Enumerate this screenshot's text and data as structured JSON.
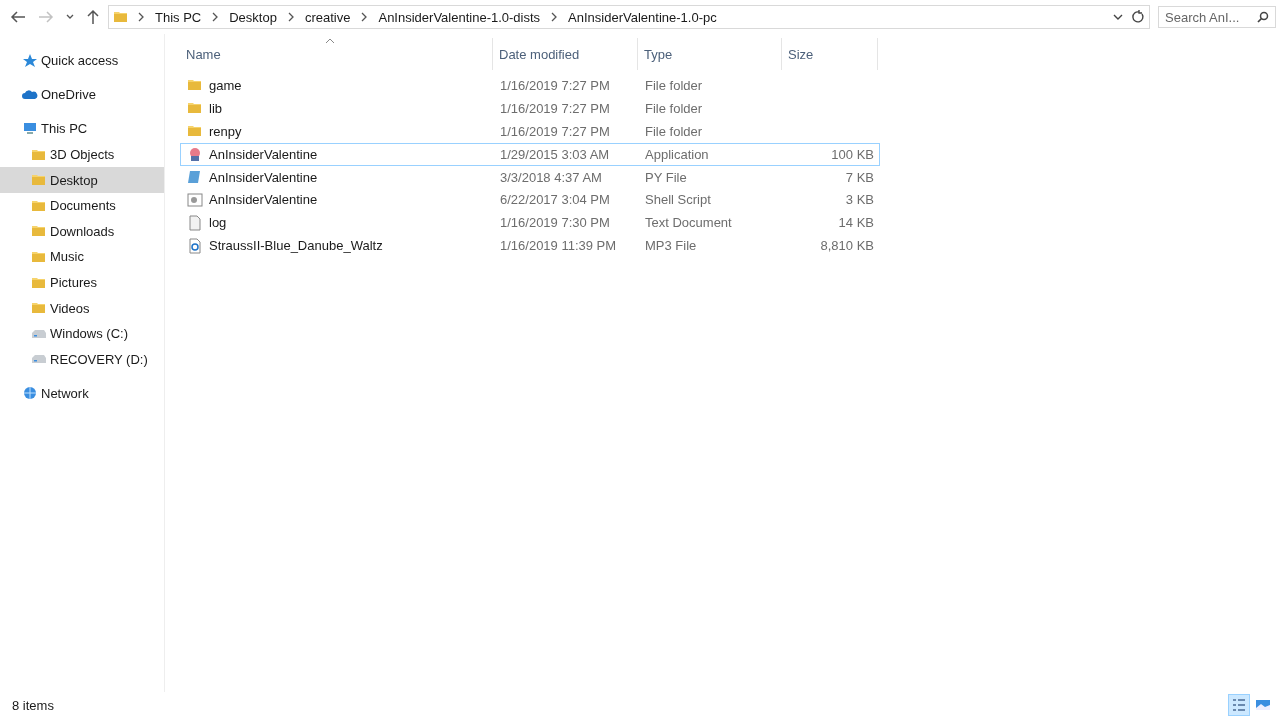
{
  "nav": {
    "back": {
      "disabled": false
    },
    "forward": {
      "disabled": true
    }
  },
  "address": {
    "segments": [
      "This PC",
      "Desktop",
      "creative",
      "AnInsiderValentine-1.0-dists",
      "AnInsiderValentine-1.0-pc"
    ]
  },
  "search": {
    "placeholder": "Search AnI..."
  },
  "sidebar": {
    "items": [
      {
        "label": "Quick access",
        "kind": "star",
        "selected": false
      },
      {
        "label": "OneDrive",
        "kind": "cloud",
        "selected": false
      },
      {
        "label": "This PC",
        "kind": "pc",
        "selected": false,
        "children": [
          {
            "label": "3D Objects",
            "kind": "folder",
            "selected": false
          },
          {
            "label": "Desktop",
            "kind": "folder",
            "selected": true
          },
          {
            "label": "Documents",
            "kind": "folder",
            "selected": false
          },
          {
            "label": "Downloads",
            "kind": "folder",
            "selected": false
          },
          {
            "label": "Music",
            "kind": "folder",
            "selected": false
          },
          {
            "label": "Pictures",
            "kind": "folder",
            "selected": false
          },
          {
            "label": "Videos",
            "kind": "folder",
            "selected": false
          },
          {
            "label": "Windows (C:)",
            "kind": "drive",
            "selected": false
          },
          {
            "label": "RECOVERY (D:)",
            "kind": "drive",
            "selected": false
          }
        ]
      },
      {
        "label": "Network",
        "kind": "network",
        "selected": false
      }
    ]
  },
  "table": {
    "columns": [
      {
        "label": "Name",
        "sorted": true
      },
      {
        "label": "Date modified",
        "sorted": false
      },
      {
        "label": "Type",
        "sorted": false
      },
      {
        "label": "Size",
        "sorted": false
      }
    ],
    "rows": [
      {
        "kind": "folder",
        "name": "game",
        "date": "1/16/2019 7:27 PM",
        "type": "File folder",
        "focused": false
      },
      {
        "kind": "folder",
        "name": "lib",
        "date": "1/16/2019 7:27 PM",
        "type": "File folder",
        "focused": false
      },
      {
        "kind": "folder",
        "name": "renpy",
        "date": "1/16/2019 7:27 PM",
        "type": "File folder",
        "focused": false
      },
      {
        "kind": "app",
        "name": "AnInsiderValentine",
        "date": "1/29/2015 3:03 AM",
        "type": "Application",
        "size": "100 KB",
        "focused": true
      },
      {
        "kind": "py",
        "name": "AnInsiderValentine",
        "date": "3/3/2018 4:37 AM",
        "type": "PY File",
        "size": "7 KB",
        "focused": false
      },
      {
        "kind": "script",
        "name": "AnInsiderValentine",
        "date": "6/22/2017 3:04 PM",
        "type": "Shell Script",
        "size": "3 KB",
        "focused": false
      },
      {
        "kind": "text",
        "name": "log",
        "date": "1/16/2019 7:30 PM",
        "type": "Text Document",
        "size": "14 KB",
        "focused": false
      },
      {
        "kind": "audio",
        "name": "StraussII-Blue_Danube_Waltz",
        "date": "1/16/2019 11:39 PM",
        "type": "MP3 File",
        "size": "8,810 KB",
        "focused": false
      }
    ]
  },
  "status_bar": {
    "count": "8 items",
    "views": [
      {
        "kind": "details",
        "selected": true
      },
      {
        "kind": "large",
        "selected": false
      }
    ]
  }
}
